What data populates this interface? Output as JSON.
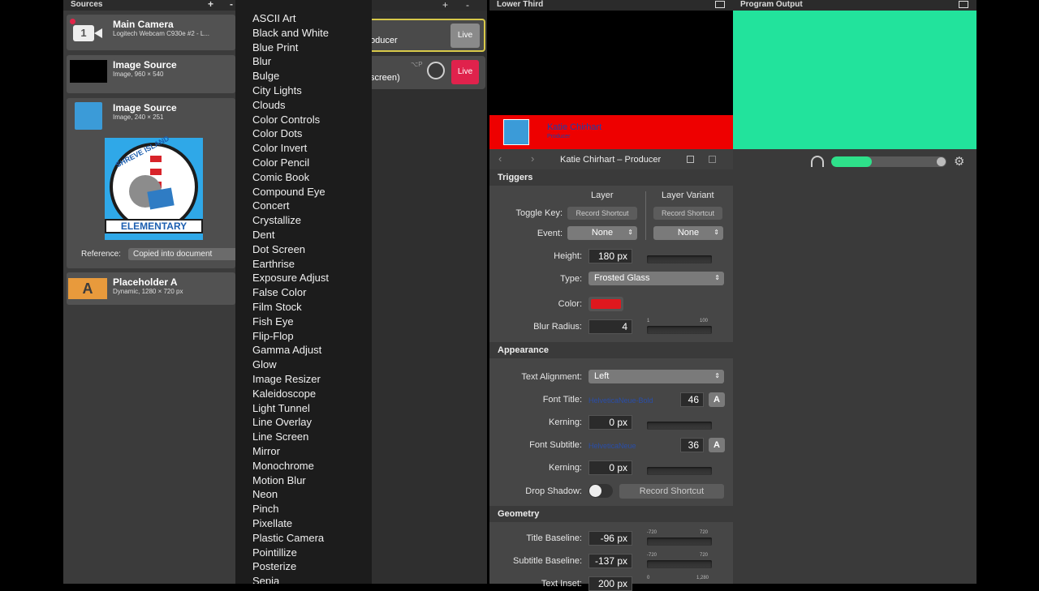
{
  "sources": {
    "title": "Sources",
    "add": "+",
    "remove": "-",
    "items": [
      {
        "title": "Main Camera",
        "subtitle": "Logitech Webcam C930e #2 - L...",
        "badge": "1"
      },
      {
        "title": "Image Source",
        "subtitle": "Image, 960 × 540"
      },
      {
        "title": "Image Source",
        "subtitle": "Image, 240 × 251",
        "reference_label": "Reference:",
        "reference_value": "Copied into document",
        "logo_top": "SHREVE ISLAND",
        "logo_bottom": "ELEMENTARY"
      },
      {
        "title": "Placeholder A",
        "subtitle": "Dynamic, 1280 × 720 px",
        "badge": "A"
      }
    ]
  },
  "layers": {
    "add": "+",
    "remove": "-",
    "row1_text": "oducer",
    "row1_live": "Live",
    "row2_text": "screen)",
    "row2_shortcut": "⌥P",
    "row2_live": "Live"
  },
  "menu": {
    "items": [
      "ASCII Art",
      "Black and White",
      "Blue Print",
      "Blur",
      "Bulge",
      "City Lights",
      "Clouds",
      "Color Controls",
      "Color Dots",
      "Color Invert",
      "Color Pencil",
      "Comic Book",
      "Compound Eye",
      "Concert",
      "Crystallize",
      "Dent",
      "Dot Screen",
      "Earthrise",
      "Exposure Adjust",
      "False Color",
      "Film Stock",
      "Fish Eye",
      "Flip-Flop",
      "Gamma Adjust",
      "Glow",
      "Image Resizer",
      "Kaleidoscope",
      "Light Tunnel",
      "Line Overlay",
      "Line Screen",
      "Mirror",
      "Monochrome",
      "Motion Blur",
      "Neon",
      "Pinch",
      "Pixellate",
      "Plastic Camera",
      "Pointillize",
      "Posterize",
      "Sepia"
    ]
  },
  "lower_third": {
    "title": "Lower Third",
    "banner_name": "Katie Chirhart",
    "banner_role": "Producer",
    "nav_title": "Katie Chirhart – Producer",
    "colors": {
      "banner": "#ee0000",
      "swatch": "#e0181e",
      "banner_text": "#1f3fa8"
    },
    "triggers": {
      "section": "Triggers",
      "layer_head": "Layer",
      "variant_head": "Layer Variant",
      "toggle_label": "Toggle Key:",
      "record_layer": "Record Shortcut",
      "record_variant": "Record Shortcut",
      "event_label": "Event:",
      "event_layer": "None",
      "event_variant": "None",
      "height_label": "Height:",
      "height_value": "180 px",
      "type_label": "Type:",
      "type_value": "Frosted Glass",
      "color_label": "Color:",
      "blur_label": "Blur Radius:",
      "blur_value": "4",
      "blur_min": "1",
      "blur_max": "100"
    },
    "appearance": {
      "section": "Appearance",
      "align_label": "Text Alignment:",
      "align_value": "Left",
      "font_title_label": "Font Title:",
      "font_title_name": "HelveticaNeue-Bold",
      "font_title_size": "46",
      "font_btn": "A",
      "kerning_label": "Kerning:",
      "kerning_value": "0 px",
      "font_sub_label": "Font Subtitle:",
      "font_sub_name": "HelveticaNeue",
      "font_sub_size": "36",
      "kerning2_label": "Kerning:",
      "kerning2_value": "0 px",
      "shadow_label": "Drop Shadow:",
      "shadow_record": "Record Shortcut"
    },
    "geometry": {
      "section": "Geometry",
      "title_base_label": "Title Baseline:",
      "title_base_value": "-96 px",
      "sub_base_label": "Subtitle Baseline:",
      "sub_base_value": "-137 px",
      "inset_label": "Text Inset:",
      "inset_value": "200 px",
      "range_min": "-720",
      "range_max": "720",
      "inset_min": "0",
      "inset_max": "1,280"
    }
  },
  "program_output": {
    "title": "Program Output",
    "level": 0.35,
    "colors": {
      "output": "#22e39c",
      "meter": "#2ee08a"
    }
  }
}
